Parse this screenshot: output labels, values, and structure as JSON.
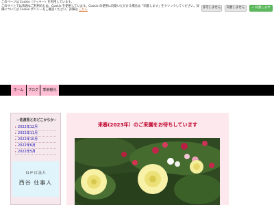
{
  "cookie": {
    "line1": "このページは Cookie（クッキー）を利用しています。",
    "line2": "このサイトでは快適なご利用のため、Cookie を使用しています。Cookie の使用に同意いただける場合は「同意します」をクリックしてください。詳細については Cookie ポリシーをご確認ください。詳細は",
    "link": "こちら",
    "reject_label": "許可しません",
    "disallow_label": "同意しません",
    "allow_label": "✓ 同意します"
  },
  "nav": {
    "items": [
      "ホーム",
      "ブログ",
      "季節観光"
    ]
  },
  "sidebar": {
    "title": "☆佐渡島とおどこからか☆",
    "items": [
      "2022年12月",
      "2022年11月",
      "2022年10月",
      "2022年6月",
      "2022年5月"
    ],
    "banner_npo": "ＮＰＯ法人",
    "banner_org": "西谷 仕事人"
  },
  "main": {
    "headline": "来春(2023年）のご来園をお待ちしています"
  },
  "colors": {
    "navbar": "#000000",
    "nav_tab": "#ffc0d6",
    "headline": "#c0002a",
    "allow_button": "#5cb85c"
  }
}
